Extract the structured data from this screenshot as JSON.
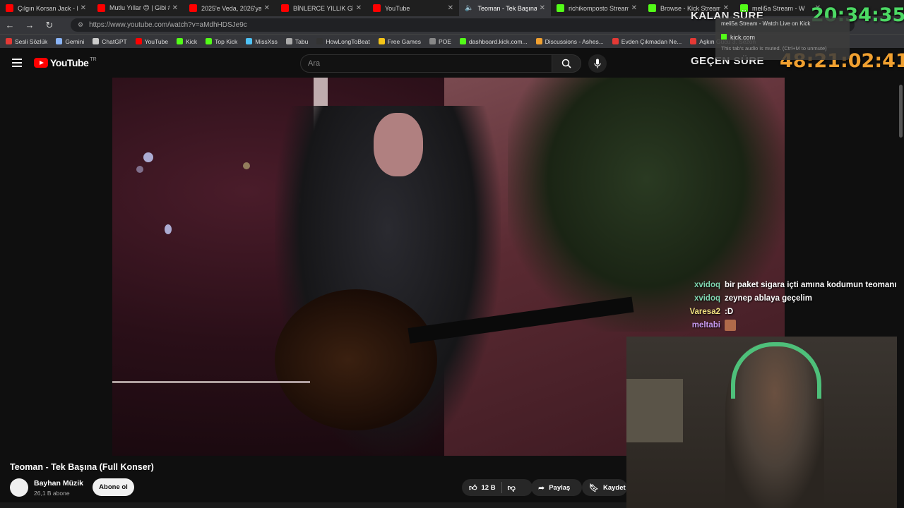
{
  "tabs": [
    {
      "label": "Çılgın Korsan Jack - Ma",
      "icon": "youtube-icon",
      "active": false
    },
    {
      "label": "Mutlu Yıllar 😊 | Gibi #si",
      "icon": "youtube-icon",
      "active": false
    },
    {
      "label": "2025'e Veda, 2026'ya M",
      "icon": "youtube-icon",
      "active": false
    },
    {
      "label": "BİNLERCE YILLIK GİZEM",
      "icon": "youtube-icon",
      "active": false
    },
    {
      "label": "YouTube",
      "icon": "youtube-icon",
      "active": false
    },
    {
      "label": "Teoman - Tek Başına",
      "icon": "muted-speaker-icon",
      "active": true
    },
    {
      "label": "richikomposto Stream",
      "icon": "kick-icon",
      "active": false
    },
    {
      "label": "Browse - Kick Streaming",
      "icon": "kick-icon",
      "active": false
    },
    {
      "label": "meli5a Stream - W",
      "icon": "kick-icon",
      "active": false
    }
  ],
  "address_bar": {
    "url": "https://www.youtube.com/watch?v=aMdhHDSJe9c"
  },
  "bookmarks": [
    {
      "label": "Sesli Sözlük",
      "color": "#e53935"
    },
    {
      "label": "Gemini",
      "color": "#8ab4f8"
    },
    {
      "label": "ChatGPT",
      "color": "#cccccc"
    },
    {
      "label": "YouTube",
      "color": "#ff0000"
    },
    {
      "label": "Kick",
      "color": "#53fc18"
    },
    {
      "label": "Top Kick",
      "color": "#53fc18"
    },
    {
      "label": "MissXss",
      "color": "#4fc3f7"
    },
    {
      "label": "Tabu",
      "color": "#aaaaaa"
    },
    {
      "label": "HowLongToBeat",
      "color": "#333333"
    },
    {
      "label": "Free Games",
      "color": "#f5c518"
    },
    {
      "label": "POE",
      "color": "#888888"
    },
    {
      "label": "dashboard.kick.com...",
      "color": "#53fc18"
    },
    {
      "label": "Discussions - Ashes...",
      "color": "#f0a030"
    },
    {
      "label": "Evden Çıkmadan Ne...",
      "color": "#e53935"
    },
    {
      "label": "Aşkın Gücü 3. Sezon",
      "color": "#e53935"
    }
  ],
  "youtube": {
    "logo_text": "YouTube",
    "region": "TR",
    "search_placeholder": "Ara"
  },
  "overlay": {
    "remaining_label": "KALAN SÜRE",
    "remaining_time": "20:34:35",
    "elapsed_label": "GEÇEN SÜRE",
    "elapsed_time": "48:21:02:41",
    "remaining_color": "#4cd964",
    "elapsed_color": "#f0a030"
  },
  "mute_popup": {
    "title": "meli5a Stream - Watch Live on Kick",
    "site": "kick.com",
    "hint": "This tab's audio is muted. (Ctrl+M to unmute)"
  },
  "chat": [
    {
      "user": "xvidoq",
      "text": "bir paket sigara içti amına kodumun teomanı",
      "color": "#7fd6b0"
    },
    {
      "user": "xvidoq",
      "text": "zeynep ablaya geçelim",
      "color": "#7fd6b0"
    },
    {
      "user": "Varesa2",
      "text": ":D",
      "color": "#f0e080"
    },
    {
      "user": "meltabi",
      "text": "",
      "color": "#c89af0",
      "emote": true
    }
  ],
  "video": {
    "title": "Teoman - Tek Başına (Full Konser)",
    "channel": "Bayhan Müzik",
    "subscribers": "26,1 B abone",
    "subscribe_label": "Abone ol",
    "likes": "12 B",
    "share_label": "Paylaş",
    "save_label": "Kaydet"
  }
}
